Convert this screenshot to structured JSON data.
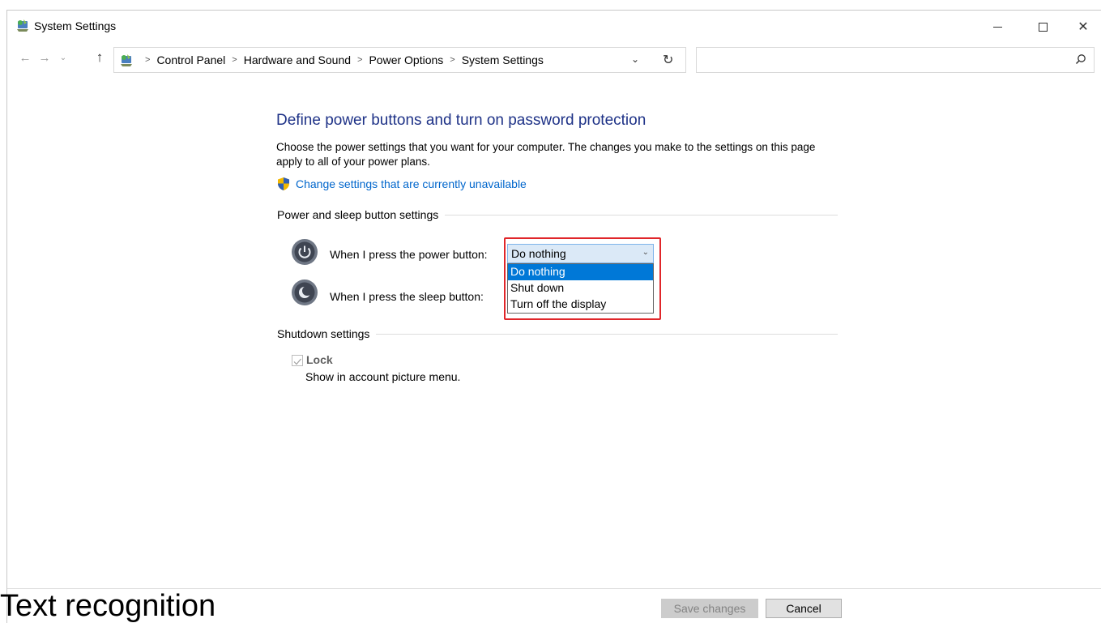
{
  "window": {
    "title": "System Settings",
    "controls": {
      "minimize": "",
      "maximize": "",
      "close": "✕"
    }
  },
  "nav": {
    "back": "←",
    "forward": "→",
    "history": "⌄",
    "up": "↑",
    "breadcrumbs": [
      "Control Panel",
      "Hardware and Sound",
      "Power Options",
      "System Settings"
    ],
    "dropdown": "⌄",
    "refresh": "↻",
    "search_placeholder": ""
  },
  "main": {
    "heading": "Define power buttons and turn on password protection",
    "description": "Choose the power settings that you want for your computer. The changes you make to the settings on this page apply to all of your power plans.",
    "change_link": "Change settings that are currently unavailable",
    "power_sleep_section": "Power and sleep button settings",
    "power_button_label": "When I press the power button:",
    "sleep_button_label": "When I press the sleep button:",
    "power_select": {
      "value": "Do nothing",
      "options": [
        "Do nothing",
        "Shut down",
        "Turn off the display"
      ],
      "selected_index": 0
    },
    "shutdown_section": "Shutdown settings",
    "lock": {
      "label": "Lock",
      "checked": true,
      "description": "Show in account picture menu."
    }
  },
  "footer": {
    "save_label": "Save changes",
    "cancel_label": "Cancel"
  },
  "overlay_text": "Text recognition",
  "colors": {
    "heading": "#1e3287",
    "link": "#0066cc",
    "selected_option": "#0078d7",
    "highlight_border": "#e0262a"
  }
}
